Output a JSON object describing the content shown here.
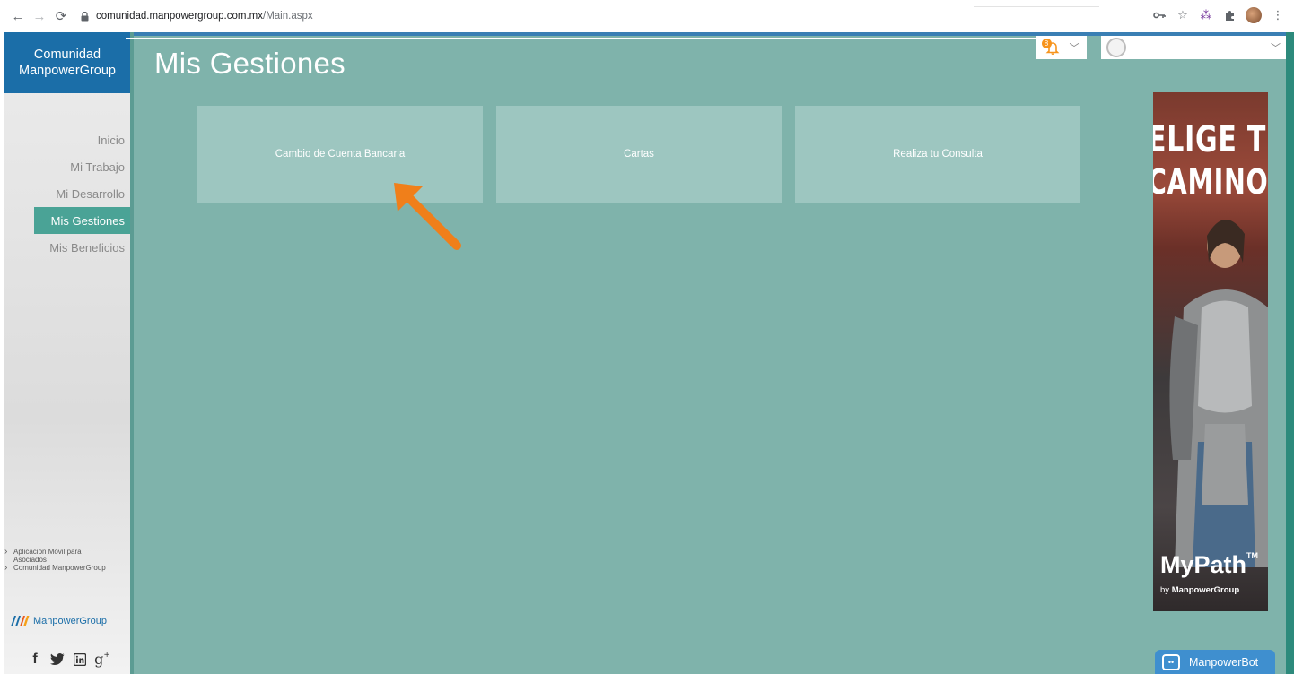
{
  "browser": {
    "url_host": "comunidad.manpowergroup.com.mx",
    "url_path": "/Main.aspx"
  },
  "sidebar": {
    "brand_line1": "Comunidad",
    "brand_line2": "ManpowerGroup",
    "items": [
      {
        "label": "Inicio"
      },
      {
        "label": "Mi Trabajo"
      },
      {
        "label": "Mi Desarrollo"
      },
      {
        "label": "Mis Gestiones",
        "active": true
      },
      {
        "label": "Mis Beneficios"
      }
    ],
    "links": [
      {
        "label": "Aplicación Móvil para",
        "label2": "Asociados"
      },
      {
        "label": "Comunidad ManpowerGroup"
      }
    ],
    "logo_text": "ManpowerGroup",
    "social": [
      "facebook-icon",
      "twitter-icon",
      "linkedin-icon",
      "google-plus-icon"
    ]
  },
  "main": {
    "title": "Mis Gestiones",
    "tiles": [
      {
        "label": "Cambio de Cuenta Bancaria"
      },
      {
        "label": "Cartas"
      },
      {
        "label": "Realiza tu Consulta"
      }
    ]
  },
  "header": {
    "notification_count": "8"
  },
  "ad": {
    "line1": "ELIGE TU",
    "line2": "CAMINO E",
    "brand": "MyPath",
    "brand_tm": "TM",
    "by_prefix": "by ",
    "by_brand": "ManpowerGroup"
  },
  "bot": {
    "label": "ManpowerBot"
  },
  "colors": {
    "main_bg": "#7fb3ab",
    "tile_bg": "#9dc6c0",
    "brand_blue": "#1b6ea8",
    "active_teal": "#4aa396",
    "arrow_orange": "#f07f1a",
    "bot_blue": "#3f8fcf"
  }
}
